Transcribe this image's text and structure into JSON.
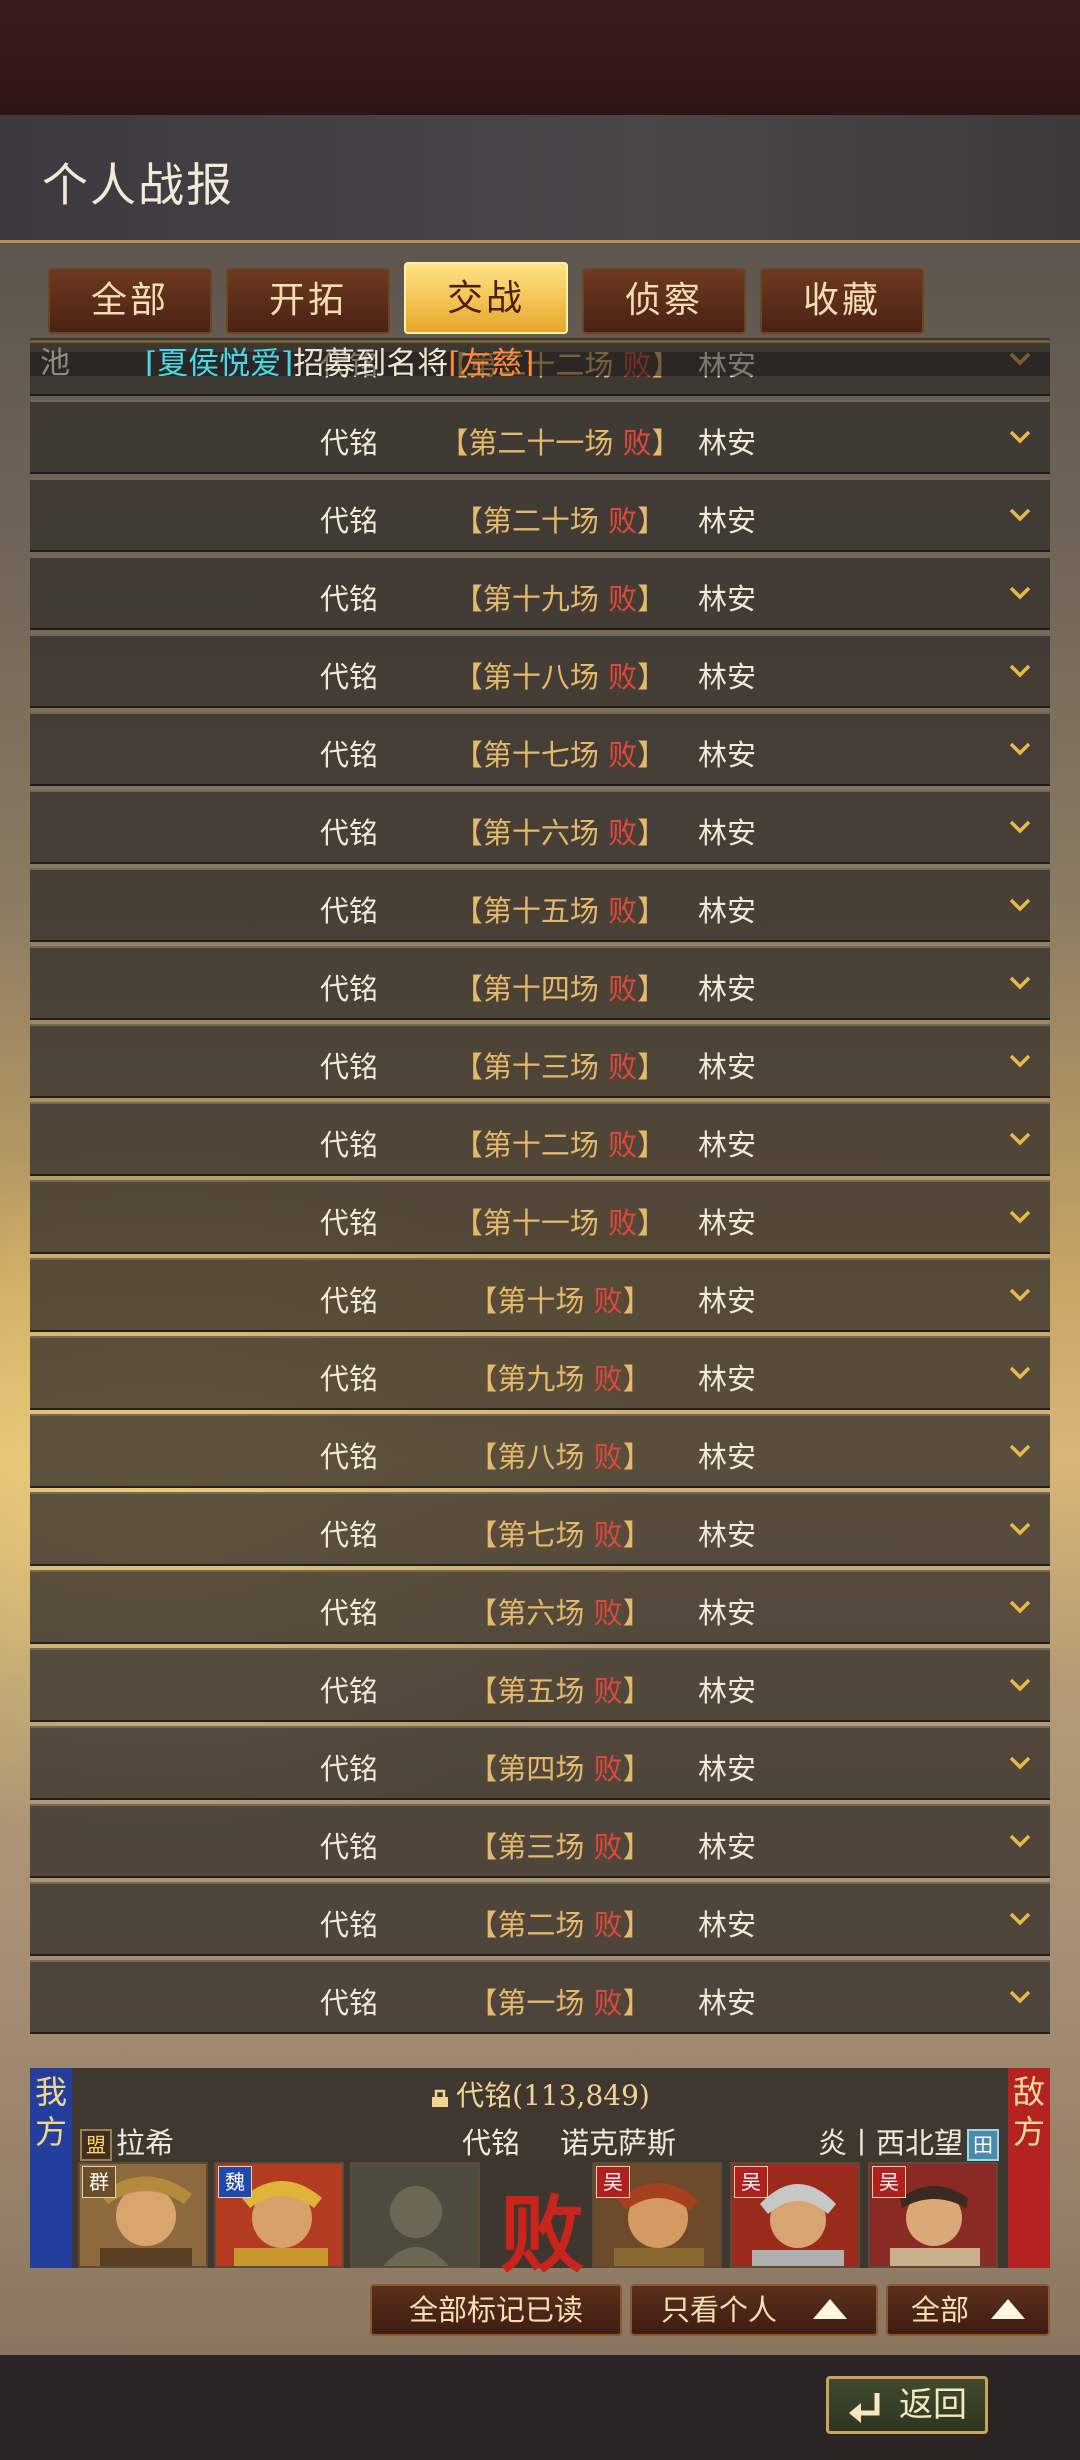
{
  "header": {
    "title": "个人战报"
  },
  "tabs": [
    {
      "label": "全部",
      "active": false
    },
    {
      "label": "开拓",
      "active": false
    },
    {
      "label": "交战",
      "active": true
    },
    {
      "label": "侦察",
      "active": false
    },
    {
      "label": "收藏",
      "active": false
    }
  ],
  "ticker": {
    "lead": "池",
    "player": "[夏侯悦爱]",
    "text": "招募到名将",
    "general": "[左慈]"
  },
  "reports": {
    "my_name": "代铭",
    "enemy_name": "林安",
    "result": "败",
    "rounds": [
      "第二十二场",
      "第二十一场",
      "第二十场",
      "第十九场",
      "第十八场",
      "第十七场",
      "第十六场",
      "第十五场",
      "第十四场",
      "第十三场",
      "第十二场",
      "第十一场",
      "第十场",
      "第九场",
      "第八场",
      "第七场",
      "第六场",
      "第五场",
      "第四场",
      "第三场",
      "第二场",
      "第一场"
    ]
  },
  "battle": {
    "mine_label": "我方",
    "enemy_label": "敌方",
    "power": "代铭(113,849)",
    "my_lord_badge": "盟",
    "my_lord": "拉希",
    "my_player": "代铭",
    "enemy_player": "诺克萨斯",
    "enemy_lord": "炎丨西北望",
    "enemy_badge": "田",
    "result": "败",
    "my_factions": [
      "群",
      "魏",
      ""
    ],
    "enemy_factions": [
      "吴",
      "吴",
      "吴"
    ]
  },
  "actions": {
    "mark_read": "全部标记已读",
    "only_me": "只看个人",
    "all": "全部"
  },
  "footer": {
    "back": "返回"
  },
  "colors": {
    "accent": "#f2b630",
    "lose": "#e2483a",
    "mine": "#243e9e",
    "enemy": "#b52222"
  }
}
